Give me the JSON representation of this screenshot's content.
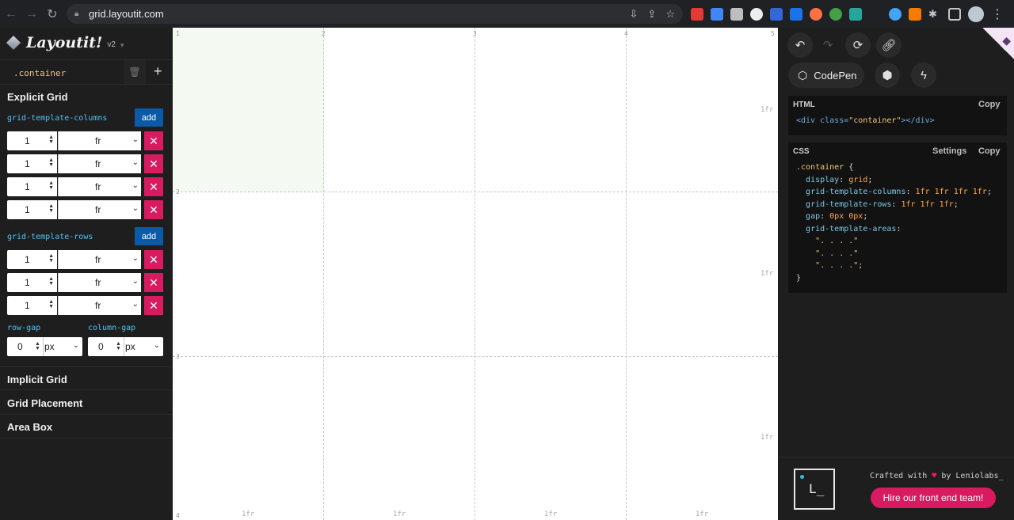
{
  "browser": {
    "url": "grid.layoutit.com"
  },
  "brand": {
    "name": "Layoutit!",
    "version": "v2"
  },
  "selector": {
    "name": ".container"
  },
  "explicit": {
    "title": "Explicit Grid",
    "columns_label": "grid-template-columns",
    "rows_label": "grid-template-rows",
    "add_label": "add",
    "columns": [
      {
        "value": "1",
        "unit": "fr"
      },
      {
        "value": "1",
        "unit": "fr"
      },
      {
        "value": "1",
        "unit": "fr"
      },
      {
        "value": "1",
        "unit": "fr"
      }
    ],
    "rows": [
      {
        "value": "1",
        "unit": "fr"
      },
      {
        "value": "1",
        "unit": "fr"
      },
      {
        "value": "1",
        "unit": "fr"
      }
    ],
    "row_gap_label": "row-gap",
    "column_gap_label": "column-gap",
    "row_gap": {
      "value": "0",
      "unit": "px"
    },
    "column_gap": {
      "value": "0",
      "unit": "px"
    }
  },
  "sections": {
    "implicit": "Implicit Grid",
    "placement": "Grid Placement",
    "area_box": "Area Box"
  },
  "canvas": {
    "col_lines": [
      "1",
      "2",
      "3",
      "4",
      "5"
    ],
    "row_lines": [
      "2",
      "3",
      "4"
    ],
    "row_sizes": [
      "1fr",
      "1fr",
      "1fr"
    ],
    "col_sizes": [
      "1fr",
      "1fr",
      "1fr",
      "1fr"
    ]
  },
  "code": {
    "codepen_label": "CodePen",
    "html_title": "HTML",
    "css_title": "CSS",
    "copy_label": "Copy",
    "settings_label": "Settings",
    "html_open": "<div",
    "html_attr": " class=",
    "html_val": "\"container\"",
    "html_close": "></div>",
    "css_selector": ".container",
    "css_lines": [
      {
        "prop": "display",
        "val": "grid"
      },
      {
        "prop": "grid-template-columns",
        "val": "1fr 1fr 1fr 1fr"
      },
      {
        "prop": "grid-template-rows",
        "val": "1fr 1fr 1fr"
      },
      {
        "prop": "gap",
        "val": "0px 0px"
      }
    ],
    "areas_prop": "grid-template-areas",
    "areas": [
      "\". . . .\"",
      "\". . . .\"",
      "\". . . .\";"
    ]
  },
  "footer": {
    "crafted_pre": "Crafted with",
    "crafted_post": "by Leniolabs_",
    "hire_label": "Hire our front end team!"
  }
}
